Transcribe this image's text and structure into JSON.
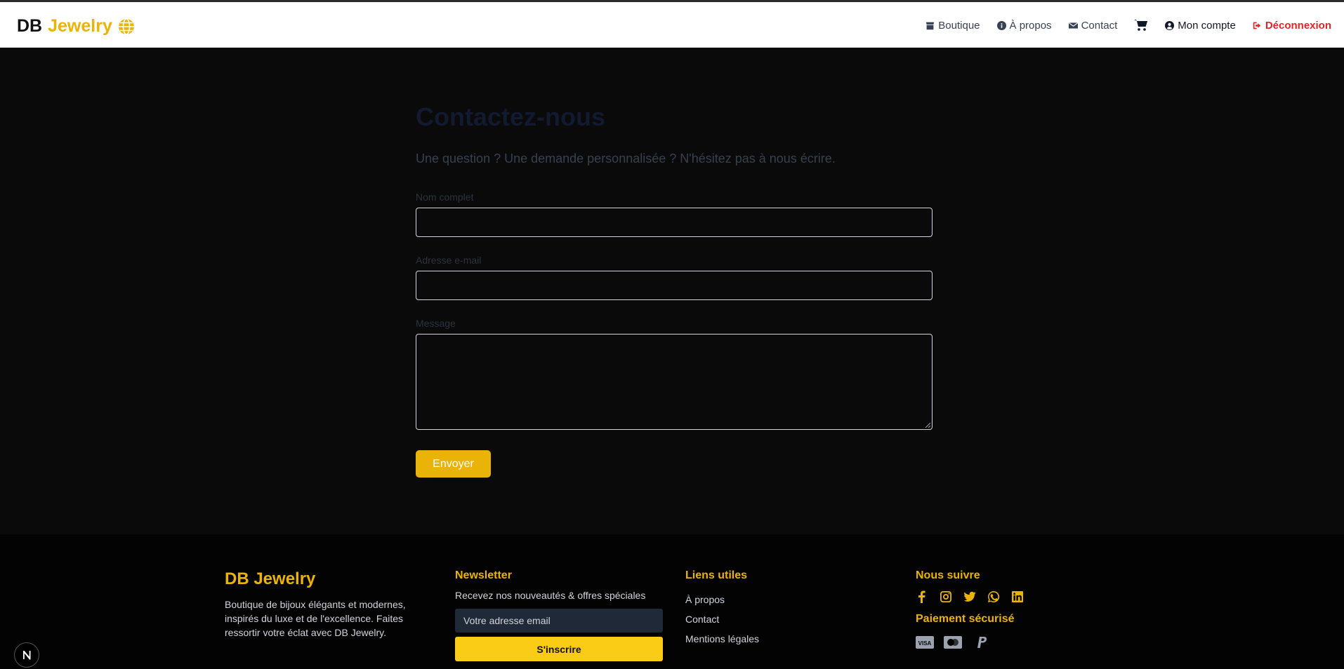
{
  "navbar": {
    "brand_prefix": "DB",
    "brand_accent": "Jewelry",
    "items": [
      {
        "label": "Boutique",
        "icon": "store-icon"
      },
      {
        "label": "À propos",
        "icon": "info-circle-icon"
      },
      {
        "label": "Contact",
        "icon": "envelope-icon"
      },
      {
        "label": "",
        "icon": "cart-icon"
      },
      {
        "label": "Mon compte",
        "icon": "user-circle-icon"
      },
      {
        "label": "Déconnexion",
        "icon": "sign-out-icon"
      }
    ]
  },
  "contact": {
    "title": "Contactez-nous",
    "subtitle": "Une question ? Une demande personnalisée ? N'hésitez pas à nous écrire.",
    "name_label": "Nom complet",
    "email_label": "Adresse e-mail",
    "message_label": "Message",
    "name_value": "",
    "email_value": "",
    "message_value": "",
    "submit_label": "Envoyer"
  },
  "footer": {
    "brand": "DB Jewelry",
    "about": "Boutique de bijoux élégants et modernes, inspirés du luxe et de l'excellence. Faites ressortir votre éclat avec DB Jewelry.",
    "newsletter_title": "Newsletter",
    "newsletter_desc": "Recevez nos nouveautés & offres spéciales",
    "newsletter_placeholder": "Votre adresse email",
    "newsletter_button": "S'inscrire",
    "links_title": "Liens utiles",
    "links": [
      "À propos",
      "Contact",
      "Mentions légales"
    ],
    "follow_title": "Nous suivre",
    "socials": [
      "facebook-icon",
      "instagram-icon",
      "twitter-icon",
      "whatsapp-icon",
      "linkedin-icon"
    ],
    "payment_title": "Paiement sécurisé",
    "payments": [
      "visa-icon",
      "mastercard-icon",
      "paypal-icon"
    ]
  },
  "colors": {
    "accent": "#eab308",
    "logout": "#dc2626",
    "background": "#0a0a0a"
  }
}
